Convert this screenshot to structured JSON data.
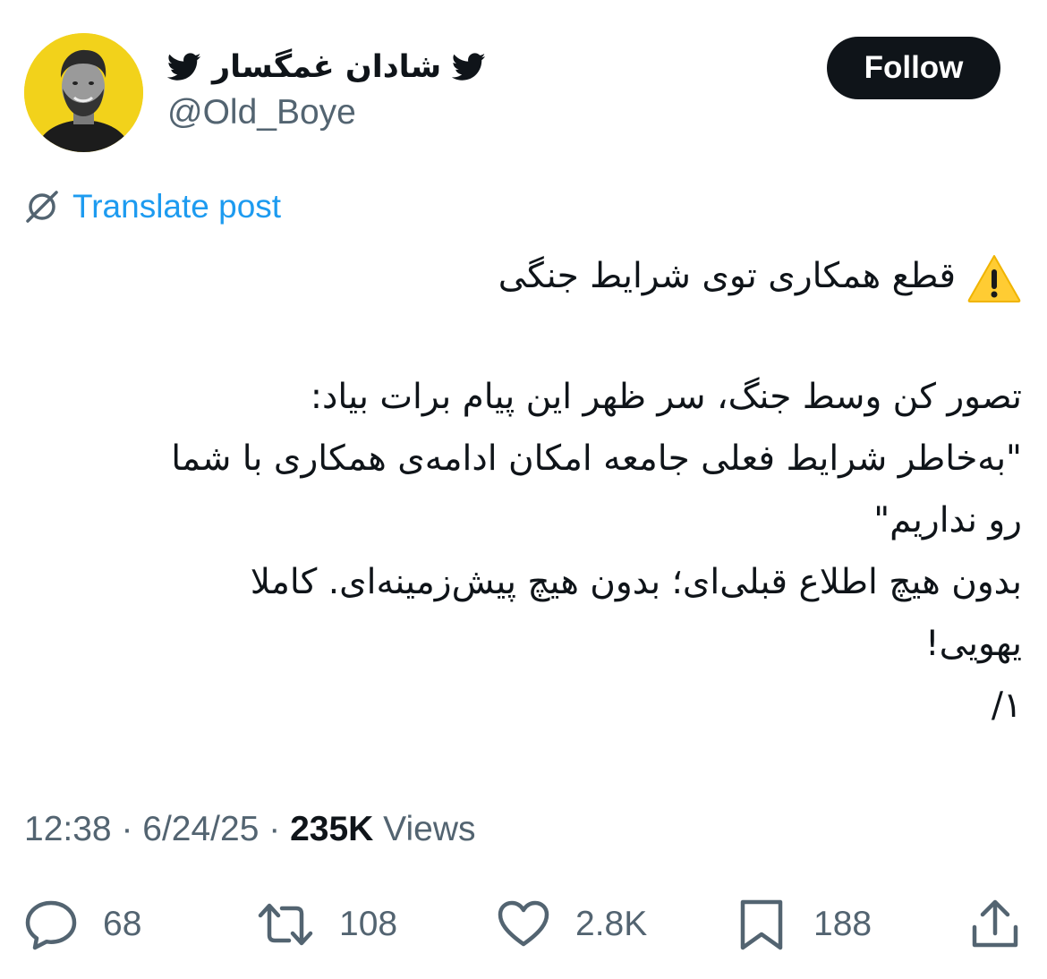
{
  "author": {
    "display_name": "شادان غمگسار",
    "handle": "@Old_Boye",
    "avatar_bg": "#f2d21b"
  },
  "follow_label": "Follow",
  "translate_label": "Translate post",
  "post": {
    "warning_icon": "warning-emoji",
    "line1": "قطع همکاری توی شرایط جنگی",
    "line2": "تصور کن وسط جنگ، سر ظهر این پیام برات بیاد:",
    "line3": "\"به‌خاطر شرایط فعلی جامعه امکان ادامه‌ی همکاری با شما",
    "line4": "رو نداریم\"",
    "line5": "بدون هیچ اطلاع قبلی‌ای؛ بدون هیچ پیش‌زمینه‌ای. کاملا",
    "line6": "یهویی!",
    "line7": "۱/"
  },
  "meta": {
    "time": "12:38",
    "date": "6/24/25",
    "views_count": "235K",
    "views_label": "Views"
  },
  "actions": {
    "replies": "68",
    "reposts": "108",
    "likes": "2.8K",
    "bookmarks": "188"
  },
  "colors": {
    "text": "#0f1419",
    "muted": "#536471",
    "link": "#1d9bf0",
    "button": "#0f1419"
  }
}
